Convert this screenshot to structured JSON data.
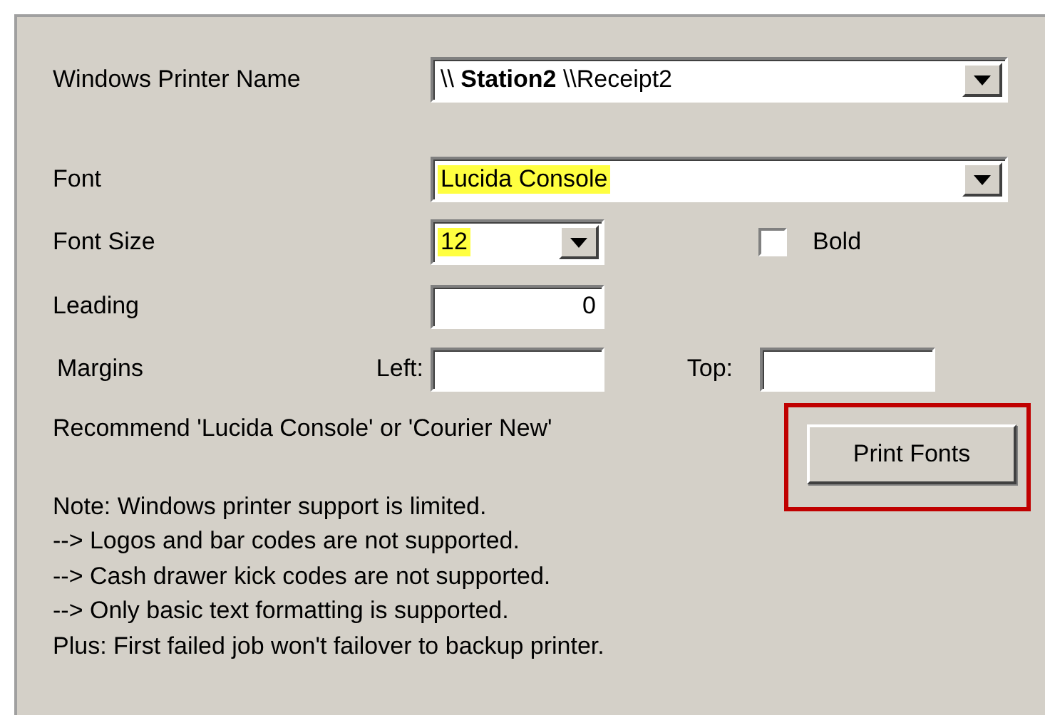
{
  "printer": {
    "label": "Windows Printer Name",
    "value": "\\\\ **Station2** \\\\Receipt2",
    "highlighted": false
  },
  "font": {
    "label": "Font",
    "value": "Lucida Console",
    "highlighted": true
  },
  "font_size": {
    "label": "Font Size",
    "value": "12",
    "highlighted": true
  },
  "bold": {
    "label": "Bold",
    "checked": false
  },
  "leading": {
    "label": "Leading",
    "value": "0"
  },
  "margins": {
    "label": "Margins",
    "left_label": "Left:",
    "top_label": "Top:"
  },
  "recommendation": "Recommend 'Lucida Console' or 'Courier New'",
  "print_fonts_button": {
    "label": "Print Fonts",
    "highlighted": true
  },
  "notes": [
    "Note:  Windows printer support is limited.",
    "-->  Logos and bar codes are not supported.",
    "-->  Cash drawer kick codes are not supported.",
    "-->  Only basic text formatting is supported.",
    "Plus: First failed job won't failover to backup printer."
  ]
}
